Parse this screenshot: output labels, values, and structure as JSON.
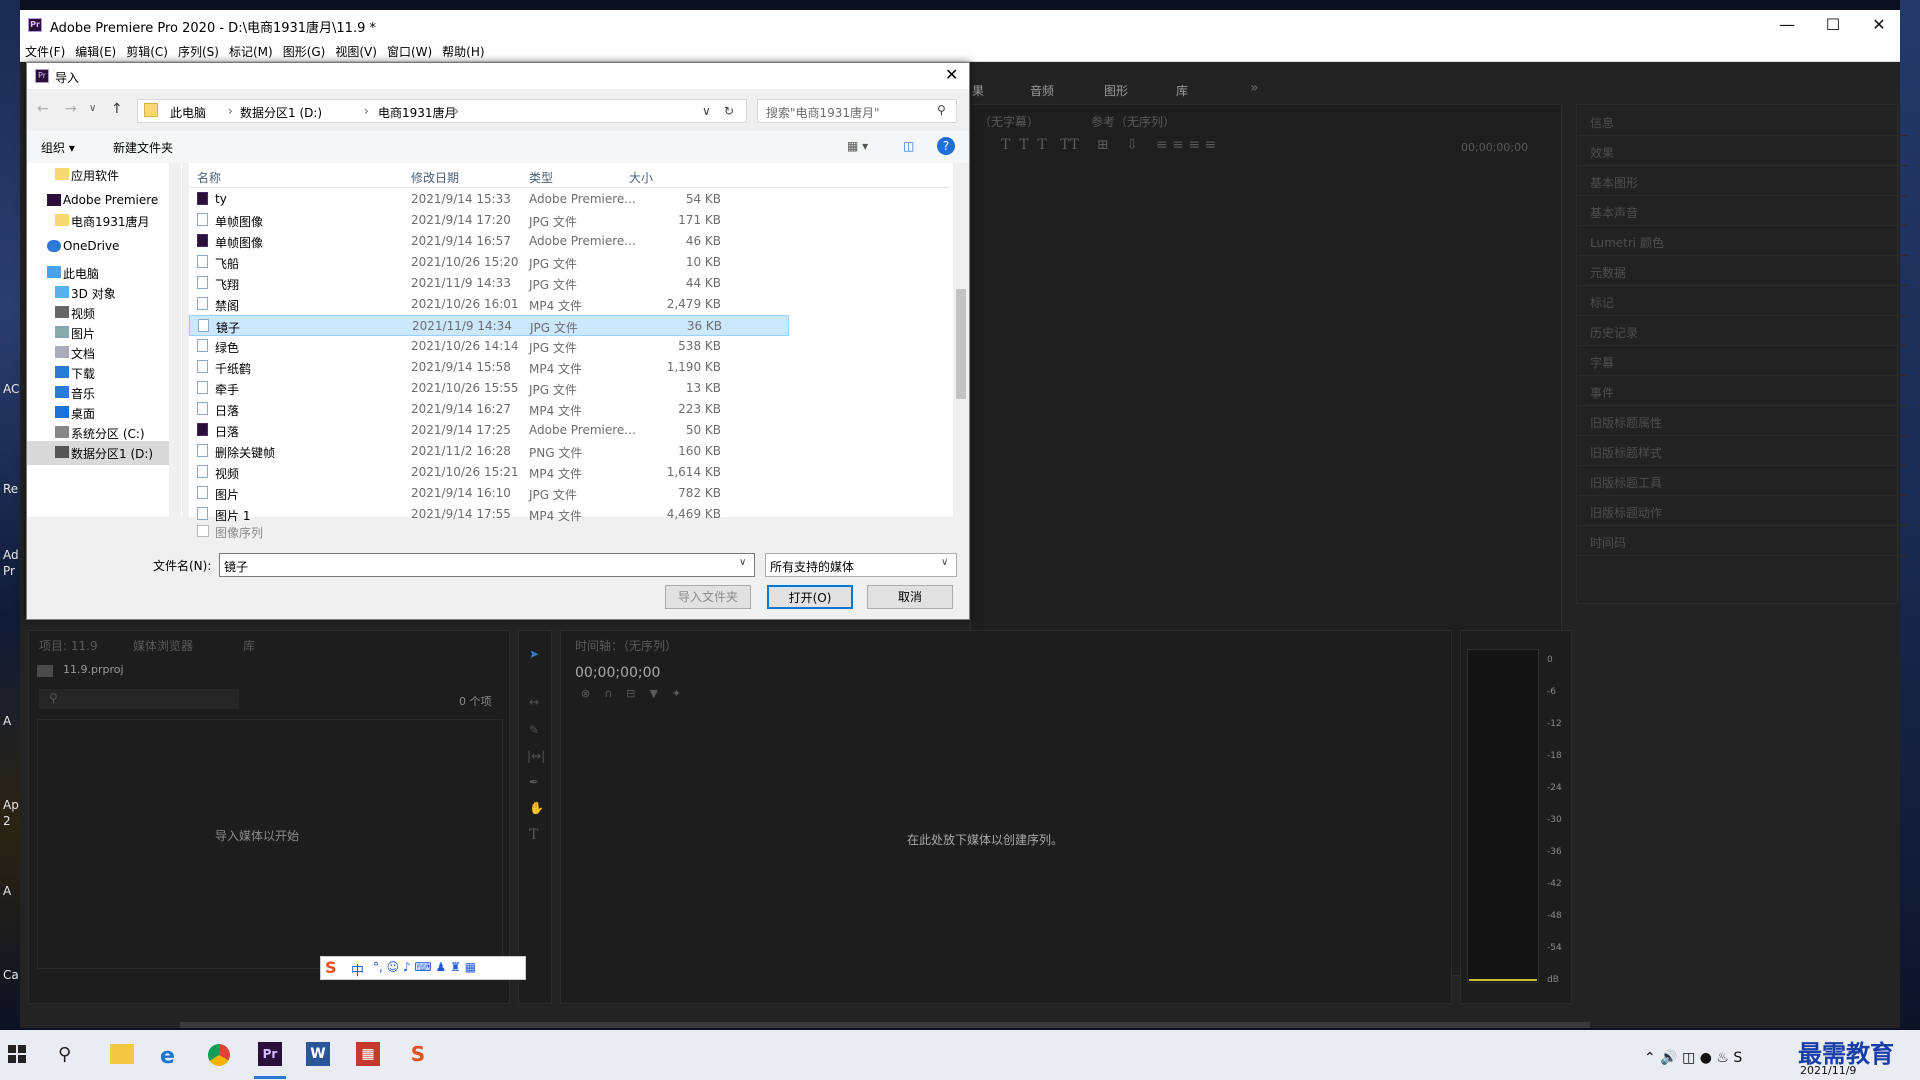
{
  "desktop": {
    "left_labels": [
      "AC",
      "Re",
      "Ad",
      "Pr",
      "A",
      "2",
      "Ap",
      "A",
      "Ca"
    ]
  },
  "app": {
    "title": "Adobe Premiere Pro 2020 - D:\\电商1931唐月\\11.9  *",
    "icon_label": "Pr"
  },
  "menu": [
    "文件(F)",
    "编辑(E)",
    "剪辑(C)",
    "序列(S)",
    "标记(M)",
    "图形(G)",
    "视图(V)",
    "窗口(W)",
    "帮助(H)"
  ],
  "workspace_tabs": [
    "果",
    "音频",
    "图形",
    "库"
  ],
  "source_panel": {
    "tab1": "（无字幕）",
    "tab2": "参考（无序列）",
    "timecode": "00;00;00;00"
  },
  "right_panels": [
    "信息",
    "效果",
    "基本图形",
    "基本声音",
    "Lumetri 颜色",
    "元数据",
    "标记",
    "历史记录",
    "字幕",
    "事件",
    "旧版标题属性",
    "旧版标题样式",
    "旧版标题工具",
    "旧版标题动作",
    "时间码"
  ],
  "project_panel": {
    "tabs": [
      "项目: 11.9",
      "媒体浏览器",
      "库"
    ],
    "file": "11.9.prproj",
    "count": "0 个项",
    "empty_msg": "导入媒体以开始"
  },
  "timeline": {
    "title": "时间轴：（无序列）",
    "timecode": "00;00;00;00",
    "empty_msg": "在此处放下媒体以创建序列。"
  },
  "meter": {
    "labels": [
      "0",
      "-6",
      "-12",
      "-18",
      "-24",
      "-30",
      "-36",
      "-42",
      "-48",
      "-54",
      "dB"
    ]
  },
  "dialog": {
    "title": "导入",
    "breadcrumb": [
      "此电脑",
      "数据分区1 (D:)",
      "电商1931唐月"
    ],
    "search_placeholder": "搜索\"电商1931唐月\"",
    "organize": "组织 ▾",
    "new_folder": "新建文件夹",
    "nav": [
      {
        "label": "应用软件",
        "icon": "folder"
      },
      {
        "label": "Adobe Premiere",
        "icon": "premiere"
      },
      {
        "label": "电商1931唐月",
        "icon": "folder"
      },
      {
        "label": "OneDrive",
        "icon": "cloud"
      },
      {
        "label": "此电脑",
        "icon": "pc"
      },
      {
        "label": "3D 对象",
        "icon": "3d"
      },
      {
        "label": "视频",
        "icon": "video"
      },
      {
        "label": "图片",
        "icon": "picture"
      },
      {
        "label": "文档",
        "icon": "doc"
      },
      {
        "label": "下载",
        "icon": "download"
      },
      {
        "label": "音乐",
        "icon": "music"
      },
      {
        "label": "桌面",
        "icon": "desktop"
      },
      {
        "label": "系统分区 (C:)",
        "icon": "drive"
      },
      {
        "label": "数据分区1 (D:)",
        "icon": "drive"
      }
    ],
    "columns": [
      "名称",
      "修改日期",
      "类型",
      "大小"
    ],
    "rows": [
      {
        "name": "ty",
        "date": "2021/9/14 15:33",
        "type": "Adobe Premiere...",
        "size": "54 KB",
        "icon": "pr"
      },
      {
        "name": "单帧图像",
        "date": "2021/9/14 17:20",
        "type": "JPG 文件",
        "size": "171 KB",
        "icon": "img"
      },
      {
        "name": "单帧图像",
        "date": "2021/9/14 16:57",
        "type": "Adobe Premiere...",
        "size": "46 KB",
        "icon": "pr"
      },
      {
        "name": "飞船",
        "date": "2021/10/26 15:20",
        "type": "JPG 文件",
        "size": "10 KB",
        "icon": "img"
      },
      {
        "name": "飞翔",
        "date": "2021/11/9 14:33",
        "type": "JPG 文件",
        "size": "44 KB",
        "icon": "img"
      },
      {
        "name": "禁阁",
        "date": "2021/10/26 16:01",
        "type": "MP4 文件",
        "size": "2,479 KB",
        "icon": "vid"
      },
      {
        "name": "镜子",
        "date": "2021/11/9 14:34",
        "type": "JPG 文件",
        "size": "36 KB",
        "icon": "img"
      },
      {
        "name": "绿色",
        "date": "2021/10/26 14:14",
        "type": "JPG 文件",
        "size": "538 KB",
        "icon": "img"
      },
      {
        "name": "千纸鹤",
        "date": "2021/9/14 15:58",
        "type": "MP4 文件",
        "size": "1,190 KB",
        "icon": "vid"
      },
      {
        "name": "牵手",
        "date": "2021/10/26 15:55",
        "type": "JPG 文件",
        "size": "13 KB",
        "icon": "img"
      },
      {
        "name": "日落",
        "date": "2021/9/14 16:27",
        "type": "MP4 文件",
        "size": "223 KB",
        "icon": "vid"
      },
      {
        "name": "日落",
        "date": "2021/9/14 17:25",
        "type": "Adobe Premiere...",
        "size": "50 KB",
        "icon": "pr"
      },
      {
        "name": "删除关键帧",
        "date": "2021/11/2 16:28",
        "type": "PNG 文件",
        "size": "160 KB",
        "icon": "img"
      },
      {
        "name": "视频",
        "date": "2021/10/26 15:21",
        "type": "MP4 文件",
        "size": "1,614 KB",
        "icon": "vid"
      },
      {
        "name": "图片",
        "date": "2021/9/14 16:10",
        "type": "JPG 文件",
        "size": "782 KB",
        "icon": "img"
      },
      {
        "name": "图片 1",
        "date": "2021/9/14 17:55",
        "type": "MP4 文件",
        "size": "4,469 KB",
        "icon": "vid"
      }
    ],
    "selected_row": 6,
    "image_sequence": "图像序列",
    "filename_label": "文件名(N):",
    "filename_value": "镜子",
    "filetype": "所有支持的媒体",
    "import_folder": "导入文件夹",
    "open": "打开(O)",
    "cancel": "取消"
  },
  "taskbar": {
    "date": "2021/11/9",
    "watermark": "最需教育",
    "ime": "中"
  }
}
